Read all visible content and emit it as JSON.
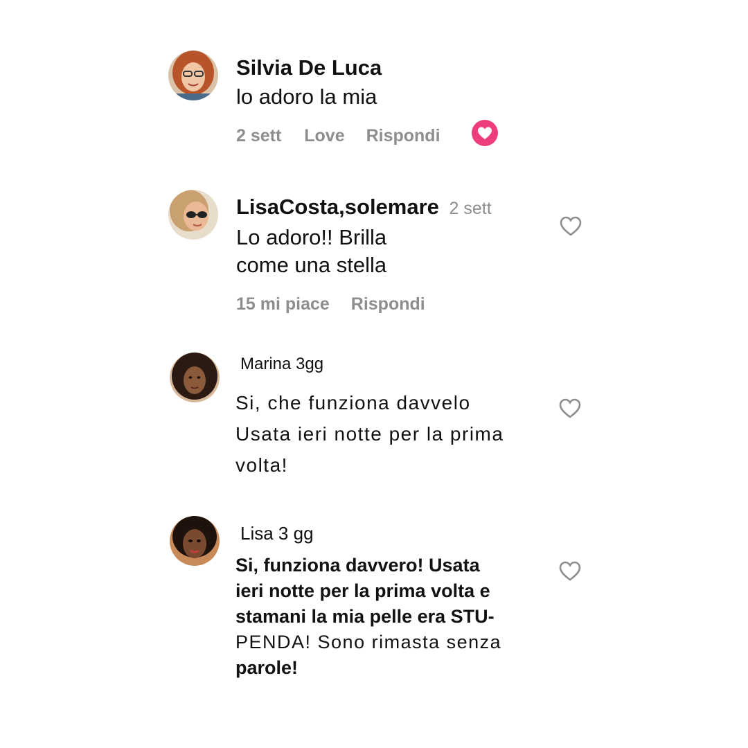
{
  "comments": [
    {
      "author": "Silvia De Luca",
      "lines": [
        "lo adoro la mia"
      ],
      "meta": {
        "time": "2 sett",
        "love": "Love",
        "reply": "Rispondi"
      },
      "liked": true,
      "avatar": "woman-glasses-red-hair-avatar"
    },
    {
      "author": "LisaCosta,solemare",
      "time": "2 sett",
      "lines": [
        "Lo adoro!! Brilla",
        "come una stella"
      ],
      "meta": {
        "likes": "15 mi piace",
        "reply": "Rispondi"
      },
      "liked": false,
      "avatar": "woman-sunglasses-avatar"
    },
    {
      "author": "Marina 3gg",
      "lines": [
        "Si, che funziona davvelo",
        "Usata ieri notte per la prima",
        "volta!"
      ],
      "liked": false,
      "avatar": "woman-curly-hair-avatar"
    },
    {
      "author": "Lisa 3 gg",
      "lines": [
        "Si, funziona davvero!  Usata",
        "ieri notte per la prima volta e",
        "stamani la mia pelle era STU-",
        "PENDA! Sono rimasta senza",
        "parole!"
      ],
      "liked": false,
      "avatar": "woman-dark-hair-avatar"
    }
  ],
  "colors": {
    "liked_heart": "#ee3d7c",
    "meta_text": "#8e8e8e",
    "outline_heart": "#8e8e8e"
  }
}
